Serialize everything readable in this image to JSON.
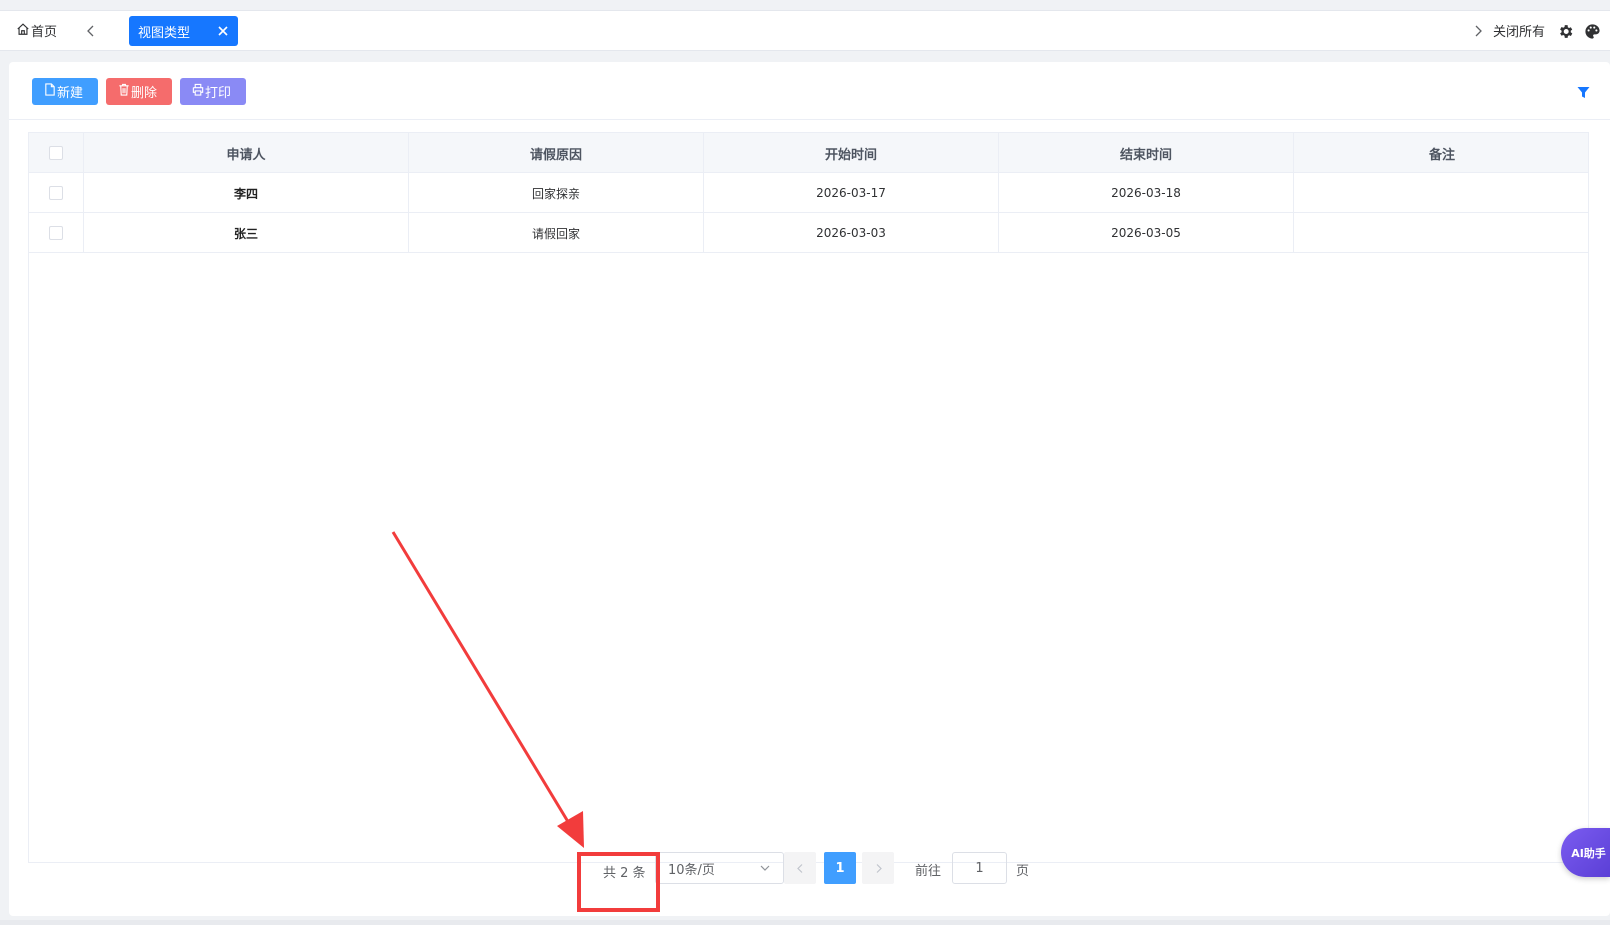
{
  "tabs": {
    "home_label": "首页",
    "active_tab": "视图类型",
    "close_all": "关闭所有"
  },
  "toolbar": {
    "new_label": "新建",
    "delete_label": "删除",
    "print_label": "打印"
  },
  "table": {
    "columns": [
      "申请人",
      "请假原因",
      "开始时间",
      "结束时间",
      "备注"
    ],
    "rows": [
      {
        "applicant": "李四",
        "reason": "回家探亲",
        "start": "2026-03-17",
        "end": "2026-03-18",
        "note": ""
      },
      {
        "applicant": "张三",
        "reason": "请假回家",
        "start": "2026-03-03",
        "end": "2026-03-05",
        "note": ""
      }
    ]
  },
  "pagination": {
    "total_text": "共 2 条",
    "page_size": "10条/页",
    "current_page": "1",
    "goto_label": "前往",
    "goto_value": "1",
    "goto_suffix": "页"
  },
  "ai_helper": "AI助手",
  "colors": {
    "primary": "#409eff",
    "active_tab": "#1677ff",
    "danger": "#f56c6c",
    "print": "#8a8af5",
    "annotation": "#f23c3c"
  }
}
